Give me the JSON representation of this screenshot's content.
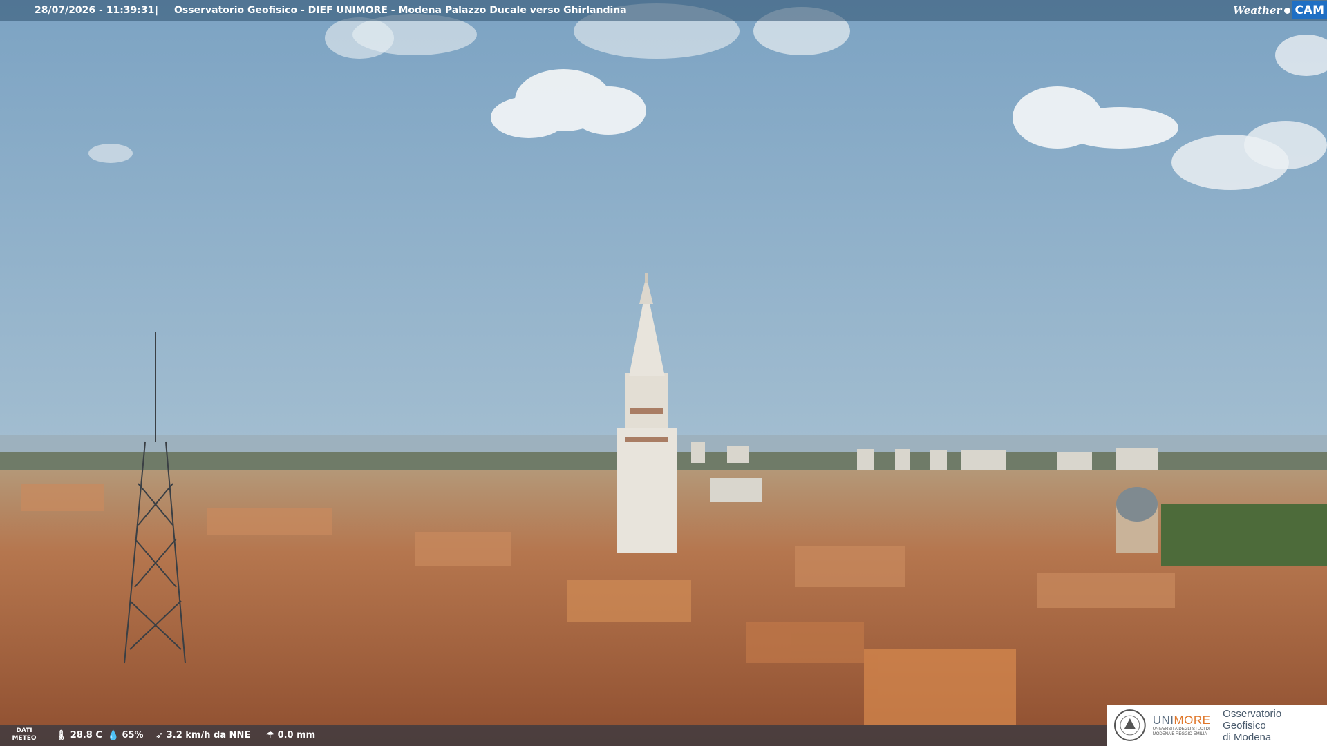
{
  "header": {
    "timestamp": "28/07/2026 - 11:39:31",
    "separator": "|",
    "title": "Osservatorio Geofisico - DIEF UNIMORE - Modena Palazzo Ducale verso Ghirlandina",
    "brand_weather": "Weather",
    "brand_cam": "CAM"
  },
  "weather": {
    "label": "DATI METEO",
    "temperature": "28.8 C",
    "humidity": "65%",
    "wind": "3.2 km/h da NNE",
    "rain": "0.0 mm",
    "icons": [
      "thermometer-icon",
      "humidity-drop-icon",
      "wind-icon",
      "rain-gauge-icon"
    ]
  },
  "logo": {
    "uni_a": "UNI",
    "uni_b": "MORE",
    "uni_sub": "UNIVERSITÀ DEGLI STUDI DI MODENA E REGGIO EMILIA",
    "observatory_line1": "Osservatorio Geofisico",
    "observatory_line2": "di Modena"
  },
  "colors": {
    "sky_top": "#7fa5c4",
    "sky_horizon": "#b7cbd6",
    "roof": "#b86e45",
    "tower": "#e8e4dc",
    "brand_blue": "#1f6fc4",
    "unimore_orange": "#e0772a"
  }
}
